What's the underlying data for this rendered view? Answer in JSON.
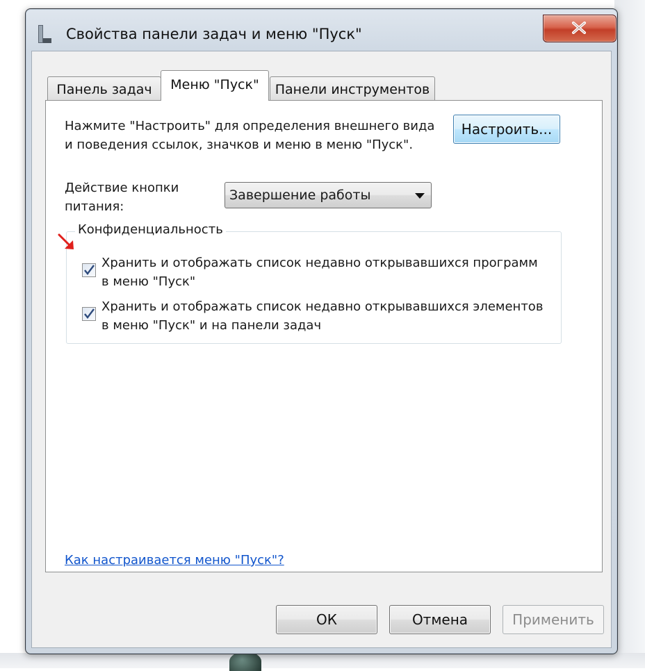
{
  "window": {
    "title": "Свойства панели задач и меню \"Пуск\"",
    "close_icon": "close-icon"
  },
  "tabs": [
    {
      "label": "Панель задач",
      "active": false
    },
    {
      "label": "Меню \"Пуск\"",
      "active": true
    },
    {
      "label": "Панели инструментов",
      "active": false
    }
  ],
  "start_menu": {
    "description": "Нажмите \"Настроить\" для определения внешнего вида и поведения ссылок, значков и меню в меню \"Пуск\".",
    "customize_label": "Настроить...",
    "power_label": "Действие кнопки питания:",
    "power_value": "Завершение работы",
    "privacy": {
      "legend": "Конфиденциальность",
      "options": [
        {
          "label": "Хранить и отображать список недавно открывавшихся программ в меню \"Пуск\"",
          "checked": true
        },
        {
          "label": "Хранить и отображать список недавно открывавшихся элементов в меню \"Пуск\" и на панели задач",
          "checked": true
        }
      ]
    },
    "help_link": "Как настраивается меню \"Пуск\"?"
  },
  "footer": {
    "ok_label": "ОК",
    "cancel_label": "Отмена",
    "apply_label": "Применить"
  },
  "colors": {
    "link": "#1155cc",
    "close_button": "#c23f28",
    "annotation_arrow": "#e0201c",
    "focus_border": "#3c7fb1"
  }
}
